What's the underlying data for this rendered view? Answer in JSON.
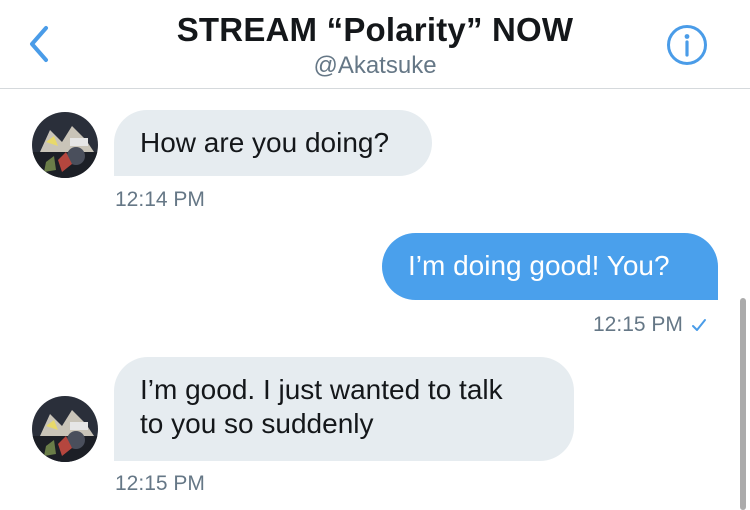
{
  "header": {
    "title": "STREAM “Polarity” NOW",
    "handle": "@Akatsuke",
    "back_icon": "chevron-left-icon",
    "info_icon": "info-circle-icon",
    "accent_color": "#4a9ce8"
  },
  "messages": [
    {
      "direction": "incoming",
      "lines": [
        "How are you doing?"
      ],
      "time": "12:14 PM"
    },
    {
      "direction": "outgoing",
      "lines": [
        "I’m doing good! You?"
      ],
      "time": "12:15 PM",
      "status_icon": "checkmark-icon"
    },
    {
      "direction": "incoming",
      "lines": [
        "I’m good. I just wanted to talk",
        "to you so suddenly"
      ],
      "time": "12:15 PM"
    }
  ],
  "colors": {
    "incoming_bubble": "#e6ecf0",
    "outgoing_bubble": "#4aa0ec",
    "timestamp_text": "#657786"
  }
}
